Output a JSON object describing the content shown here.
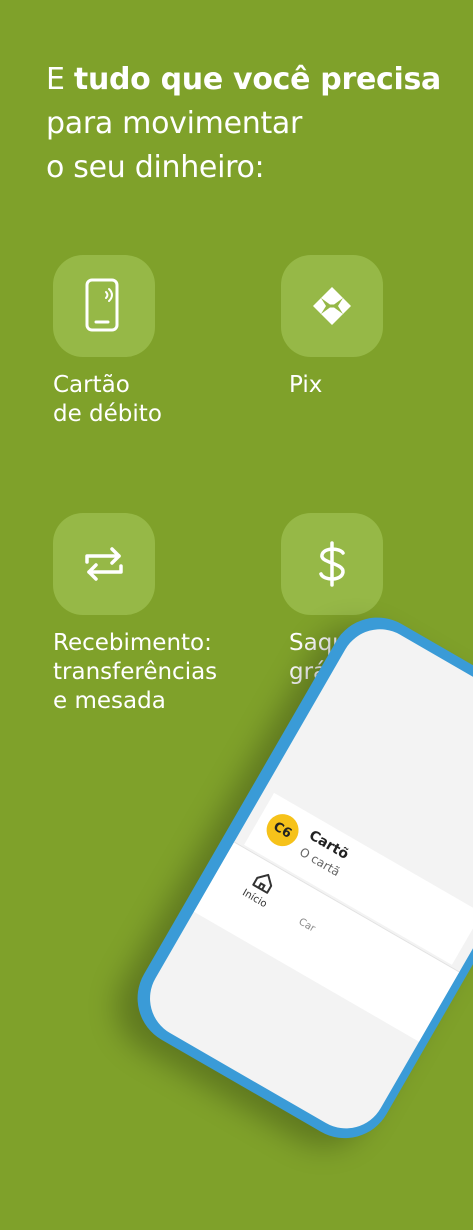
{
  "headline": {
    "part1": "E ",
    "bold": "tudo que você precisa",
    "part2": "para movimentar",
    "part3": "o seu dinheiro:"
  },
  "features": [
    {
      "icon": "phone-contactless-icon",
      "label": "Cartão\nde débito"
    },
    {
      "icon": "pix-icon",
      "label": "Pix"
    },
    {
      "icon": "transfer-arrows-icon",
      "label": "Recebimento:\ntransferências\ne mesada"
    },
    {
      "icon": "dollar-icon",
      "label": "Saque\ngrátis"
    }
  ],
  "phone": {
    "badge": "C6",
    "card_title": "Cartõ",
    "card_sub": "O cartã",
    "tab_home": "Início",
    "tab_card": "Car"
  },
  "colors": {
    "background": "#7fa12a",
    "tile": "#96b847",
    "phone_frame": "#3a9bd7",
    "badge": "#f6c21a"
  }
}
